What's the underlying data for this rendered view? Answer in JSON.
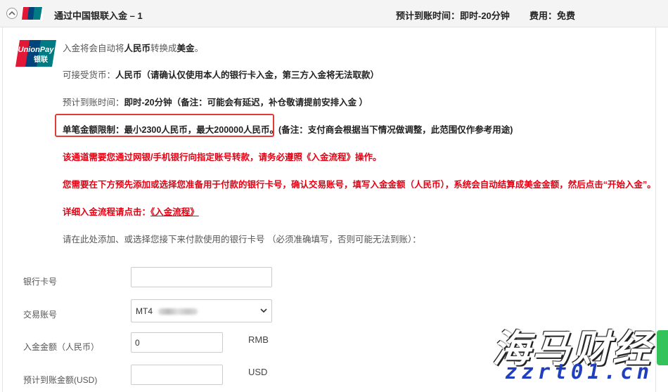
{
  "header": {
    "logo_text_top": "UnionPay",
    "logo_text_bottom": "银联",
    "title": "通过中国银联入金 – 1",
    "eta": "预计到账时间：即时-20分钟",
    "fee": "费用：免费"
  },
  "info": {
    "auto_convert_pre": "入金将会自动将",
    "auto_convert_from": "人民币",
    "auto_convert_mid": "转换成",
    "auto_convert_to": "美金",
    "auto_convert_end": "。",
    "currency_label": "可接受货币：",
    "currency_value": "人民币（请确认仅使用本人的银行卡入金，第三方入金将无法取款）",
    "eta_label": "预计到账时间：",
    "eta_value": "即时-20分钟（备注：可能会有延迟，补仓敬请提前安排入金 ）",
    "limit_value": "单笔金额限制：最小2300人民币，最大200000人民币。",
    "limit_note": "(备注：支付商会根据当下情况做调整，此范围仅作参考用途)",
    "red_line_1": "该通道需要您通过网银/手机银行向指定账号转款，请务必遵照《入金流程》操作。",
    "red_line_2": "您需要在下方预先添加或选择您准备用于付款的银行卡号，确认交易账号，填写入金金额（人民币），系统会自动结算成美金金额，然后点击“开始入金”。",
    "red_line_3_label": "详细入金流程请点击：",
    "red_line_3_link": "《入金流程》",
    "instruction": "请在此处添加、或选择您接下来付款使用的银行卡号 （必须准确填写，否则可能无法到账）："
  },
  "form": {
    "card_label": "银行卡号",
    "card_value": "",
    "account_label": "交易账号",
    "account_selected": "MT4",
    "amount_label": "入金金额（人民币）",
    "amount_value": "0",
    "amount_unit": "RMB",
    "usd_label": "预计到账金额(USD)",
    "usd_value": "",
    "usd_unit": "USD"
  },
  "watermark": {
    "cn": "海马财经",
    "en": "zzrt01.cn"
  },
  "colors": {
    "accent_red": "#e60012",
    "highlight_box": "#e53935",
    "unionpay_red": "#e21836",
    "unionpay_blue": "#00447c",
    "unionpay_teal": "#007b84"
  }
}
